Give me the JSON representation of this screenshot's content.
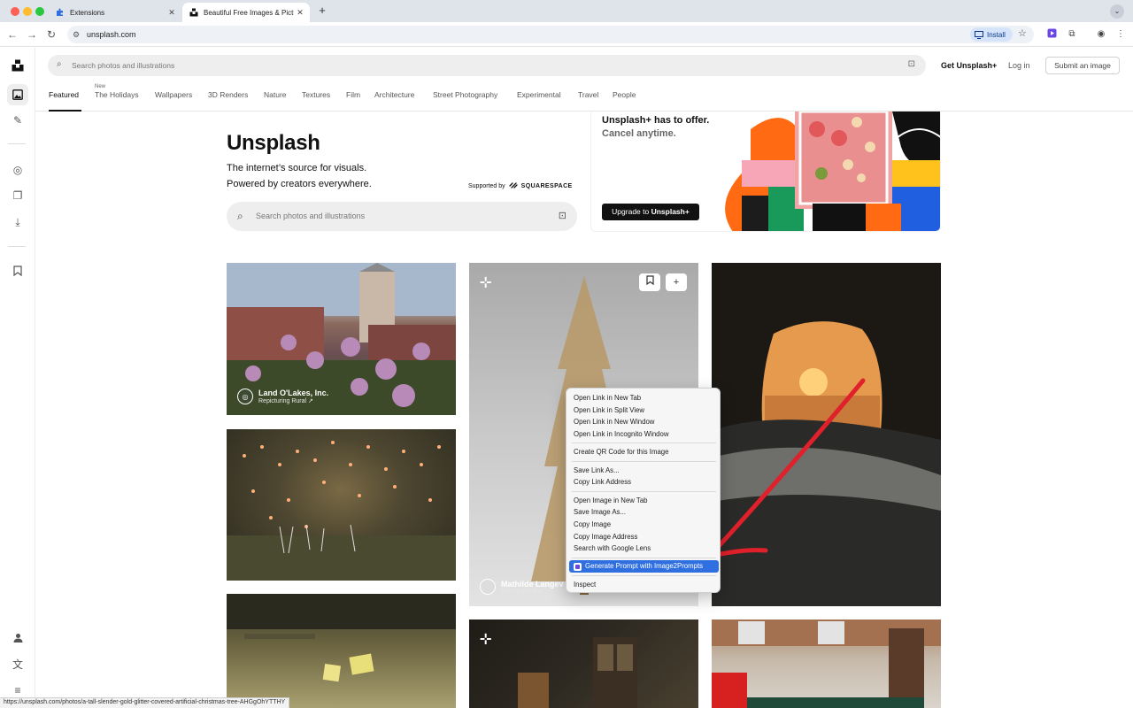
{
  "browser": {
    "tabs": [
      {
        "label": "Extensions"
      },
      {
        "label": "Beautiful Free Images & Pictures"
      }
    ],
    "url": "unsplash.com",
    "install_label": "Install",
    "status_url": "https://unsplash.com/photos/a-tall-slender-gold-glitter-covered-artificial-christmas-tree-AHGgOhYTTHY"
  },
  "header": {
    "search_placeholder": "Search photos and illustrations",
    "get_plus": "Get Unsplash+",
    "login": "Log in",
    "submit": "Submit an image"
  },
  "categories": {
    "new_badge": "New",
    "items": [
      "Featured",
      "The Holidays",
      "Wallpapers",
      "3D Renders",
      "Nature",
      "Textures",
      "Film",
      "Architecture",
      "Street Photography",
      "Experimental",
      "Travel",
      "People"
    ]
  },
  "hero": {
    "title": "Unsplash",
    "line1": "The internet’s source for visuals.",
    "line2": "Powered by creators everywhere.",
    "supported_by": "Supported by",
    "sponsor": "SQUARESPACE",
    "search_placeholder": "Search photos and illustrations"
  },
  "promo": {
    "line1": "Unsplash+ has to offer.",
    "line2": "Cancel anytime.",
    "button_prefix": "Upgrade to ",
    "button_brand": "Unsplash+"
  },
  "photos": {
    "p1_name": "Land O'Lakes, Inc.",
    "p1_sub": "Repicturing Rural ↗",
    "p4_name": "Mathilde Langev",
    "p4_sub": "For Unsplash+"
  },
  "context_menu": {
    "group1": [
      "Open Link in New Tab",
      "Open Link in Split View",
      "Open Link in New Window",
      "Open Link in Incognito Window"
    ],
    "group2": [
      "Create QR Code for this Image"
    ],
    "group3": [
      "Save Link As...",
      "Copy Link Address"
    ],
    "group4": [
      "Open Image in New Tab",
      "Save Image As...",
      "Copy Image",
      "Copy Image Address",
      "Search with Google Lens"
    ],
    "highlighted": "Generate Prompt with Image2Prompts",
    "inspect": "Inspect"
  },
  "colors": {
    "accent_blue": "#2f6fe0",
    "annotation_red": "#e0202a"
  }
}
